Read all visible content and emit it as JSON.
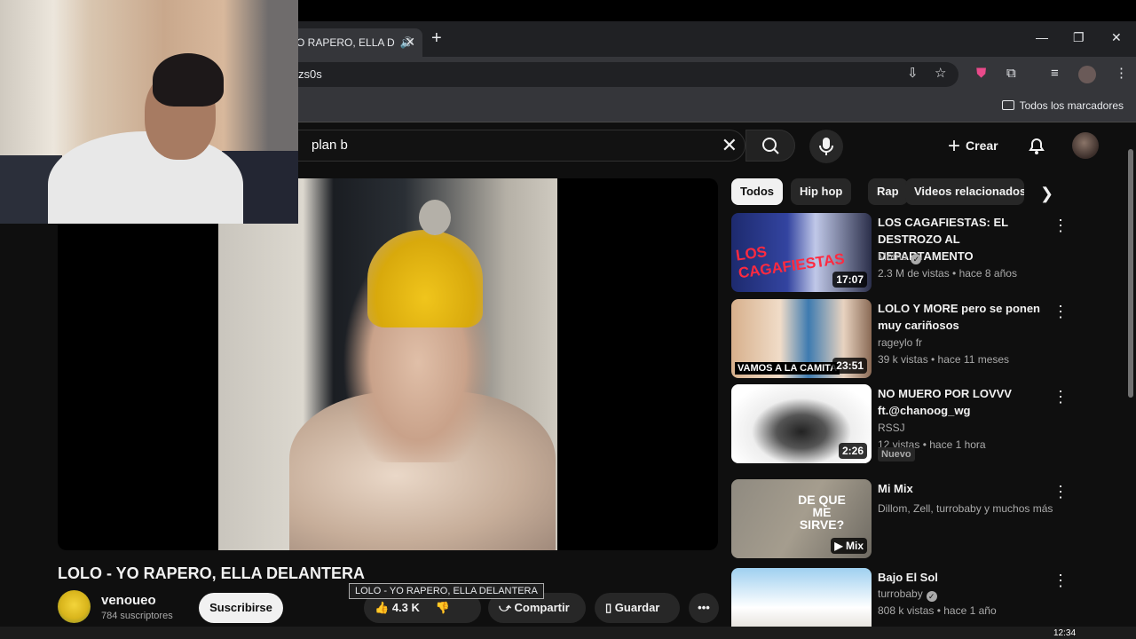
{
  "browser": {
    "tab_title": "O RAPERO, ELLA D",
    "url": "zs0s",
    "bookmarks_label": "Todos los marcadores"
  },
  "youtube": {
    "search_query": "plan b",
    "create_label": "Crear"
  },
  "chips": [
    "Todos",
    "Hip hop",
    "Rap",
    "Videos relacionados"
  ],
  "recommendations": [
    {
      "title": "LOS CAGAFIESTAS: EL DESTROZO AL DEPARTAMENTO",
      "channel": "Momo",
      "verified": true,
      "meta": "2.3 M de vistas • hace 8 años",
      "duration": "17:07",
      "thumb_text": "LOS CAGAFIESTAS"
    },
    {
      "title": "LOLO Y MORE pero se ponen muy cariñosos",
      "channel": "rageylo fr",
      "meta": "39 k vistas • hace 11 meses",
      "duration": "23:51",
      "thumb_text": "VAMOS A LA CAMITA"
    },
    {
      "title": "NO MUERO POR LOVVV ft.@chanoog_wg",
      "channel": "RSSJ",
      "meta": "12 vistas • hace 1 hora",
      "duration": "2:26",
      "badge": "Nuevo"
    },
    {
      "title": "Mi Mix",
      "channel": "Dillom, Zell, turrobaby y muchos más",
      "duration": "Mix",
      "thumb_text": "DE QUE ME SIRVE?"
    },
    {
      "title": "Bajo El Sol",
      "channel": "turrobaby",
      "verified": true,
      "meta": "808 k vistas • hace 1 año"
    }
  ],
  "video": {
    "title": "LOLO - YO RAPERO, ELLA DELANTERA",
    "tooltip": "LOLO - YO RAPERO, ELLA DELANTERA",
    "channel": "venoueo",
    "subscribers": "784 suscriptores",
    "subscribe_label": "Suscribirse",
    "likes": "4.3 K",
    "share_label": "Compartir",
    "save_label": "Guardar"
  },
  "taskbar": {
    "time": "12:34"
  }
}
